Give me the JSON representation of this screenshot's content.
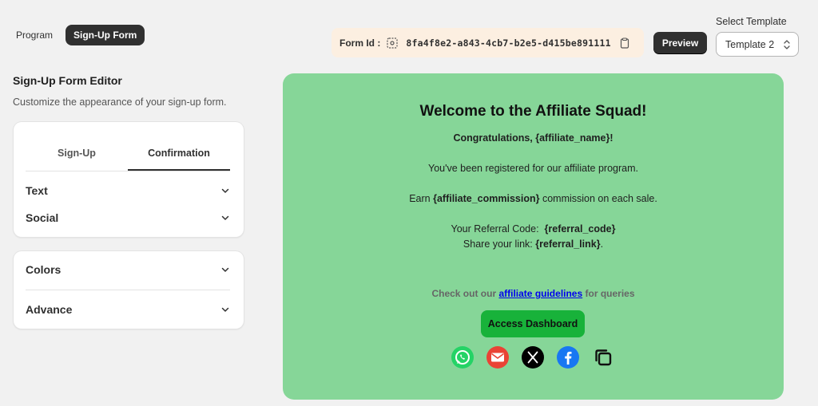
{
  "top_tabs": [
    {
      "label": "Program"
    },
    {
      "label": "Sign-Up Form"
    }
  ],
  "form_id": {
    "label": "Form Id :",
    "value": "8fa4f8e2-a843-4cb7-b2e5-d415be891111"
  },
  "preview_button": "Preview",
  "template": {
    "label": "Select Template",
    "selected": "Template 2"
  },
  "editor": {
    "title": "Sign-Up Form Editor",
    "subtitle": "Customize the appearance of your sign-up form.",
    "tabs": [
      {
        "label": "Sign-Up"
      },
      {
        "label": "Confirmation"
      }
    ],
    "sections1": [
      {
        "label": "Text"
      },
      {
        "label": "Social"
      }
    ],
    "sections2": [
      {
        "label": "Colors"
      },
      {
        "label": "Advance"
      }
    ]
  },
  "preview": {
    "title": "Welcome to the Affiliate Squad!",
    "congrats": "Congratulations, {affiliate_name}!",
    "registered": "You've been registered for our affiliate program.",
    "earn_prefix": "Earn",
    "earn_var": "{affiliate_commission}",
    "earn_suffix": "commission on each sale.",
    "referral_prefix": "Your Referral Code:",
    "referral_var": "{referral_code}",
    "share_prefix": "Share your link:",
    "share_var": "{referral_link}",
    "share_suffix": ".",
    "guidelines_prefix": "Check out our",
    "guidelines_link": "affiliate guidelines",
    "guidelines_suffix": "for queries",
    "dashboard_button": "Access Dashboard",
    "social_icons": [
      "whatsapp-icon",
      "email-icon",
      "x-icon",
      "facebook-icon",
      "copy-icon"
    ]
  },
  "colors": {
    "preview_bg": "#86d698",
    "dashboard_button": "#18b23a",
    "active_tab": "#303030",
    "form_id_bg": "#fcefe1"
  }
}
